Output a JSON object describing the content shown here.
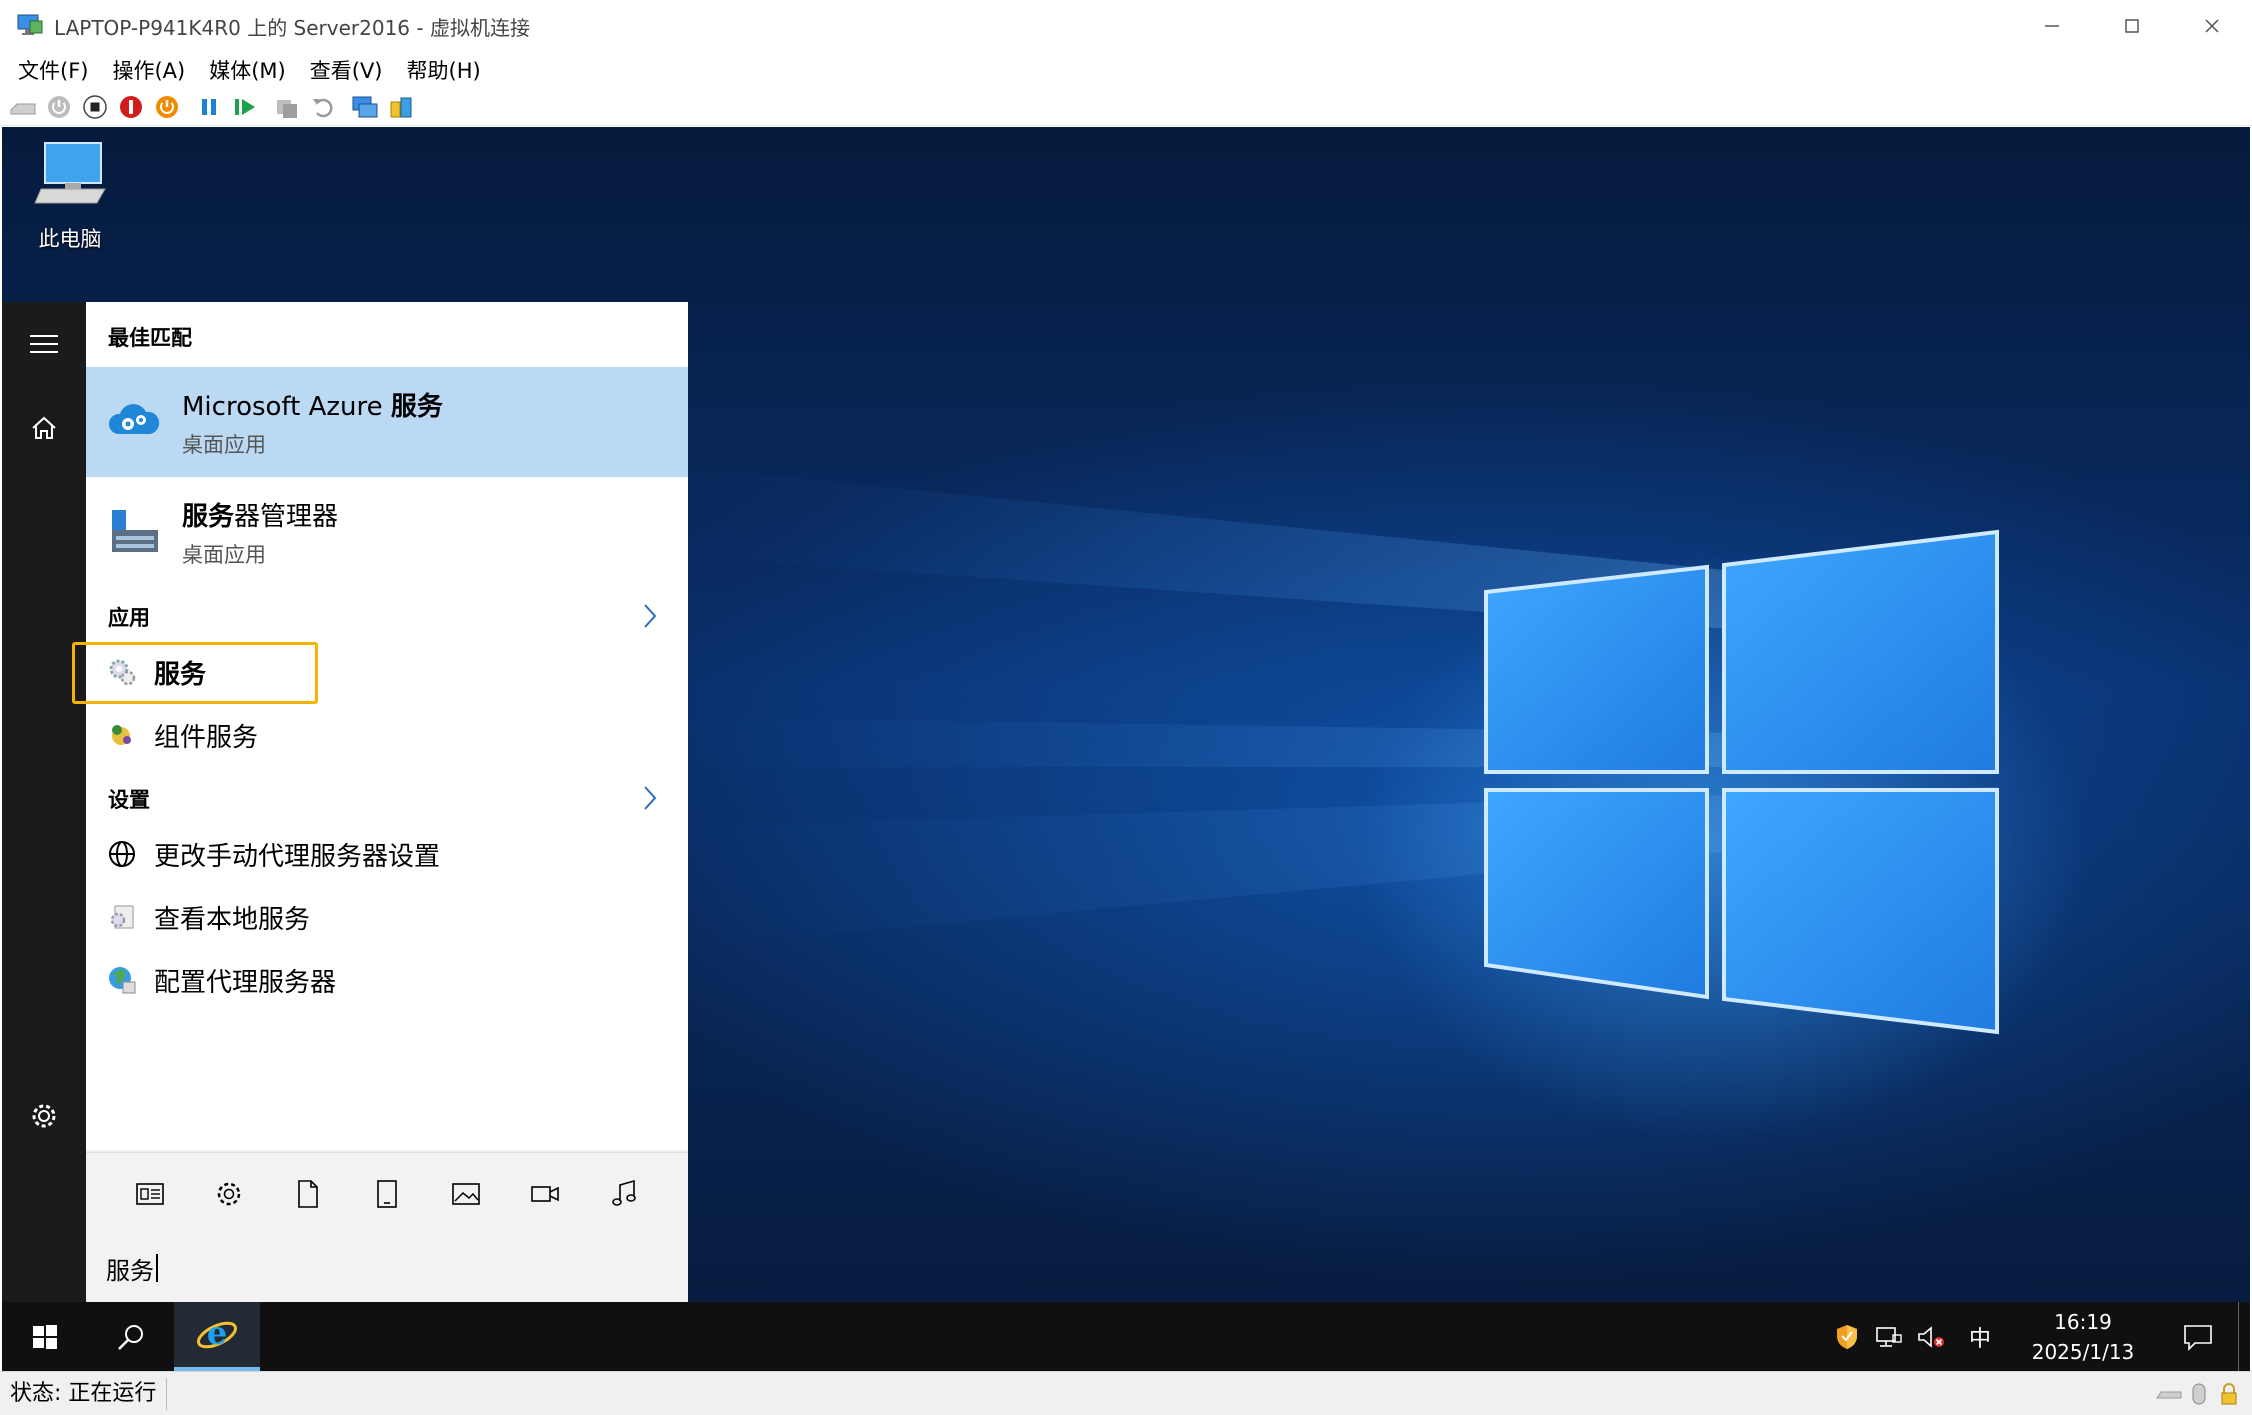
{
  "window": {
    "title": "LAPTOP-P941K4R0 上的 Server2016 - 虚拟机连接",
    "controls": {
      "minimize": "—",
      "maximize": "☐",
      "close": "✕"
    }
  },
  "menubar": {
    "items": [
      "文件(F)",
      "操作(A)",
      "媒体(M)",
      "查看(V)",
      "帮助(H)"
    ]
  },
  "toolbar": {
    "icons": [
      "ctrl-alt-del-icon",
      "start-icon",
      "turn-off-icon",
      "shutdown-icon",
      "save-icon",
      "pause-icon",
      "resume-icon",
      "checkpoint-icon",
      "revert-icon",
      "enhanced-session-icon",
      "share-icon"
    ]
  },
  "desktop": {
    "icons": [
      {
        "label": "此电脑",
        "icon": "computer-icon"
      }
    ]
  },
  "search_panel": {
    "best_match_header": "最佳匹配",
    "best_match": [
      {
        "title_prefix": "Microsoft Azure ",
        "title_bold": "服务",
        "subtitle": "桌面应用",
        "icon": "azure-cloud-gear-icon",
        "selected": true
      },
      {
        "title_prefix": "",
        "title_bold": "服务",
        "title_suffix": "器管理器",
        "subtitle": "桌面应用",
        "icon": "server-manager-icon",
        "selected": false
      }
    ],
    "apps_header": "应用",
    "apps": [
      {
        "label": "服务",
        "bold": true,
        "icon": "services-gear-icon",
        "highlighted": true
      },
      {
        "label": "组件服务",
        "bold": false,
        "icon": "component-services-icon"
      }
    ],
    "settings_header": "设置",
    "settings": [
      {
        "label": "更改手动代理服务器设置",
        "icon": "globe-icon"
      },
      {
        "label": "查看本地服务",
        "icon": "local-services-icon"
      },
      {
        "label": "配置代理服务器",
        "icon": "proxy-globe-icon"
      }
    ],
    "filters": [
      "apps-filter-icon",
      "settings-filter-icon",
      "documents-filter-icon",
      "tablet-filter-icon",
      "photos-filter-icon",
      "videos-filter-icon",
      "music-filter-icon"
    ],
    "search_value": "服务"
  },
  "taskbar": {
    "tray_ime": "中",
    "time": "16:19",
    "date": "2025/1/13"
  },
  "statusbar": {
    "status": "状态: 正在运行"
  },
  "colors": {
    "selection": "#bcd9f3",
    "focus_outline": "#f5b400",
    "taskbar": "#101010",
    "start_rail": "#1b1b1b"
  }
}
